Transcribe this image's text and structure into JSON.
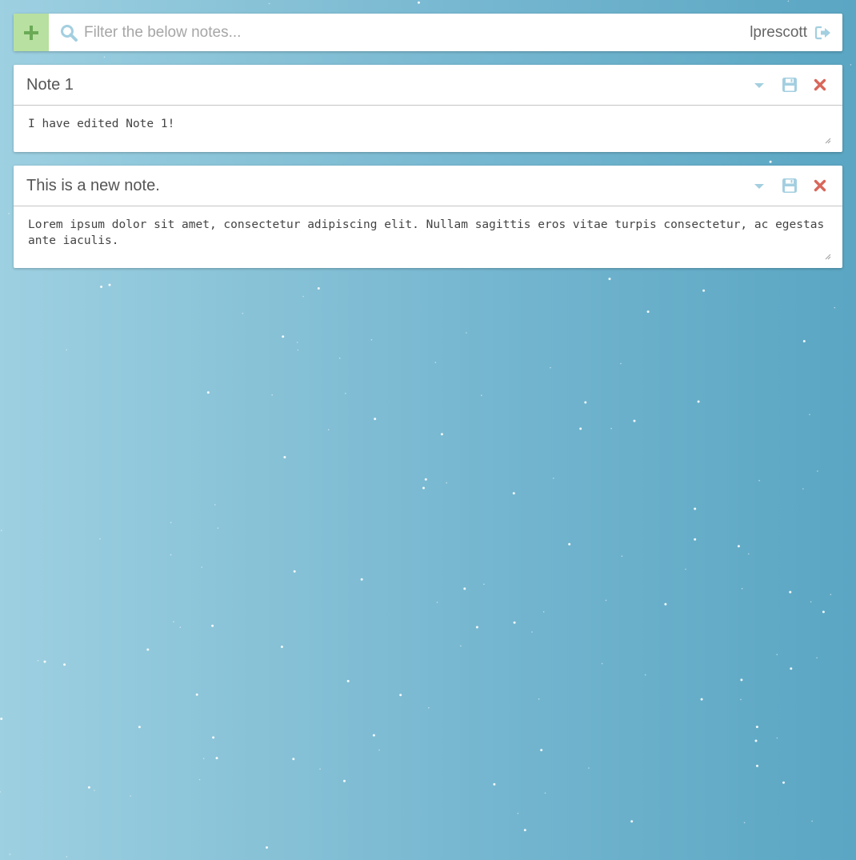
{
  "toolbar": {
    "search_placeholder": "Filter the below notes...",
    "username": "lprescott",
    "add_icon": "plus-icon",
    "search_icon": "search-icon",
    "logout_icon": "logout-icon"
  },
  "notes": [
    {
      "title": "Note 1",
      "body": "I have edited Note 1!"
    },
    {
      "title": "This is a new note.",
      "body": "Lorem ipsum dolor sit amet, consectetur adipiscing elit. Nullam sagittis eros vitae turpis consectetur, ac egestas ante iaculis."
    }
  ],
  "colors": {
    "add_button_bg": "#b8e0a0",
    "add_icon": "#6aaa56",
    "search_icon": "#a3cfe0",
    "action_icon": "#a3cfe0",
    "delete_icon": "#d9665a",
    "background_start": "#9dd0e1",
    "background_end": "#5aa6c3"
  }
}
